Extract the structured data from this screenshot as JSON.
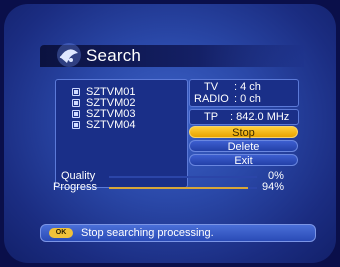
{
  "header": {
    "title": "Search",
    "icon": "satellite-dish-icon"
  },
  "channels": [
    {
      "name": "SZTVM01"
    },
    {
      "name": "SZTVM02"
    },
    {
      "name": "SZTVM03"
    },
    {
      "name": "SZTVM04"
    }
  ],
  "counts": {
    "tv_label": "TV",
    "tv_value": ": 4 ch",
    "radio_label": "RADIO",
    "radio_value": ": 0 ch"
  },
  "transponder": {
    "label": "TP",
    "value": ": 842.0 MHz"
  },
  "buttons": {
    "stop": "Stop",
    "delete": "Delete",
    "exit": "Exit"
  },
  "meters": {
    "quality_label": "Quality",
    "quality_value": "0%",
    "quality_fraction": 0.0,
    "progress_label": "Progress",
    "progress_value": "94%",
    "progress_fraction": 0.94
  },
  "status": {
    "ok_label": "OK",
    "message": "Stop searching processing."
  },
  "colors": {
    "accent": "#f0c23a",
    "panel": "#1a2f88",
    "meter_fill": "#d8a638"
  }
}
